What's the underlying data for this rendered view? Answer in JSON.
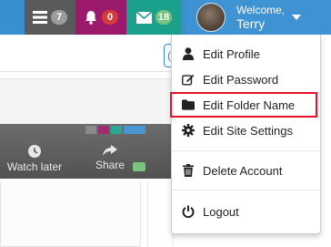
{
  "topbar": {
    "tasks": {
      "icon": "tasks-icon",
      "count": "7"
    },
    "alerts": {
      "icon": "bell-icon",
      "count": "0"
    },
    "messages": {
      "icon": "envelope-icon",
      "count": "18"
    },
    "user": {
      "greeting": "Welcome,",
      "name": "Terry"
    }
  },
  "background": {
    "watch_later": "Watch later",
    "share": "Share"
  },
  "menu": {
    "items": [
      {
        "label": "Edit Profile",
        "icon": "user-icon"
      },
      {
        "label": "Edit Password",
        "icon": "edit-icon"
      },
      {
        "label": "Edit Folder Name",
        "icon": "folder-icon"
      },
      {
        "label": "Edit Site Settings",
        "icon": "gear-icon"
      },
      {
        "label": "Delete Account",
        "icon": "trash-icon"
      },
      {
        "label": "Logout",
        "icon": "power-icon"
      }
    ]
  },
  "colors": {
    "topbar": "#3a8fd0",
    "tasks_bg": "#5a5a5a",
    "alerts_bg": "#9c1a6b",
    "messages_bg": "#1ba08b",
    "highlight": "#e8102a"
  }
}
